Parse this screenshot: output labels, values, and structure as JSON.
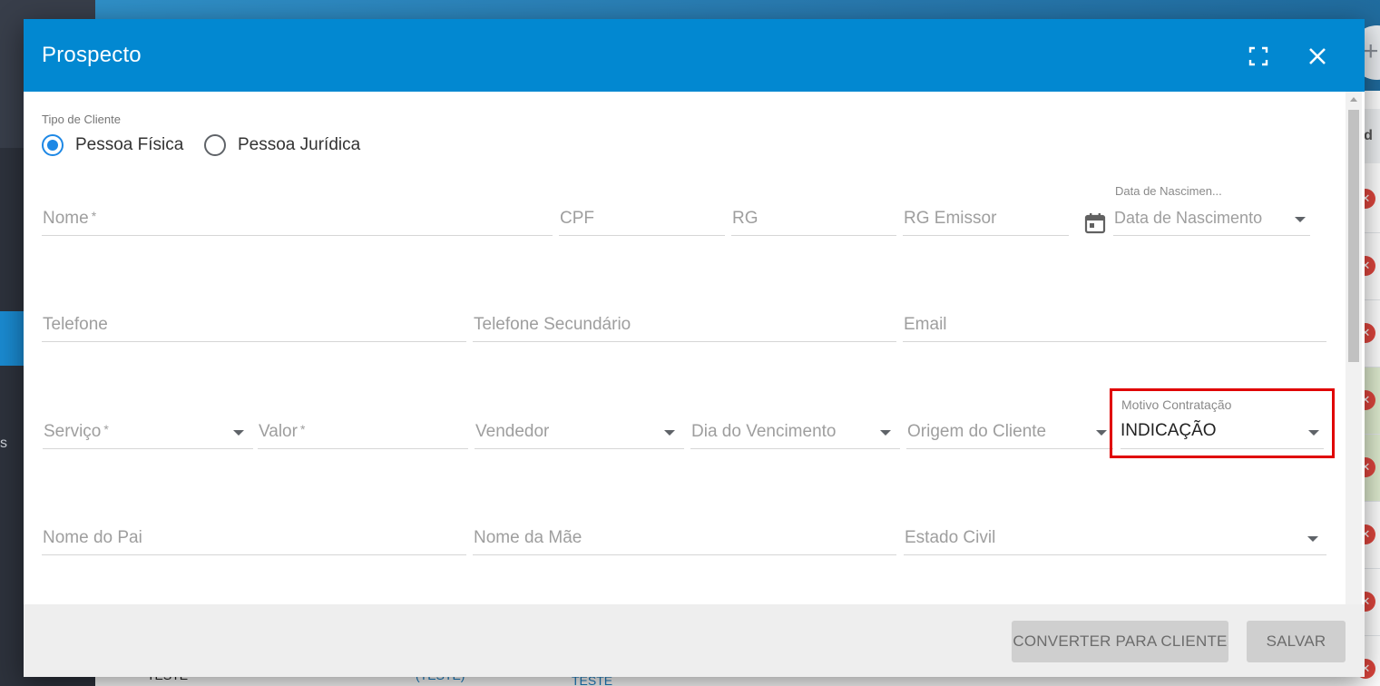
{
  "modal": {
    "title": "Prospecto",
    "tipo_cliente": {
      "label": "Tipo de Cliente",
      "options": [
        "Pessoa Física",
        "Pessoa Jurídica"
      ],
      "selected": "Pessoa Física"
    },
    "row1": {
      "nome": "Nome",
      "cpf": "CPF",
      "rg": "RG",
      "rg_emissor": "RG Emissor",
      "data_nascimento_label": "Data de Nascimen...",
      "data_nascimento": "Data de Nascimento"
    },
    "row2": {
      "telefone": "Telefone",
      "telefone_secundario": "Telefone Secundário",
      "email": "Email"
    },
    "row3": {
      "servico": "Serviço",
      "valor": "Valor",
      "vendedor": "Vendedor",
      "dia_vencimento": "Dia do Vencimento",
      "origem_cliente": "Origem do Cliente",
      "motivo_label": "Motivo Contratação",
      "motivo_value": "INDICAÇÃO"
    },
    "row4": {
      "nome_pai": "Nome do Pai",
      "nome_mae": "Nome da Mãe",
      "estado_civil": "Estado Civil"
    },
    "required_mark": "*",
    "footer": {
      "converter": "CONVERTER PARA CLIENTE",
      "salvar": "SALVAR"
    }
  },
  "background": {
    "sidebar_text": "s",
    "table_header": "erd",
    "fab": "+",
    "row_action": "✕",
    "bottom_cells": [
      "TESTE",
      "(TESTE)",
      "TESTE"
    ]
  },
  "colors": {
    "header": "#0288d1",
    "radio_checked": "#1e88e5",
    "highlight": "#e00000"
  },
  "icons": [
    "fullscreen-icon",
    "close-icon",
    "calendar-icon",
    "chevron-down-icon"
  ]
}
